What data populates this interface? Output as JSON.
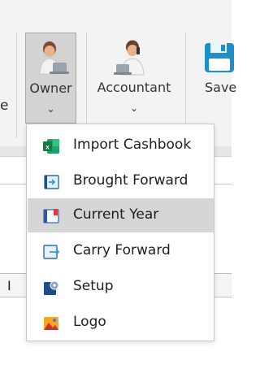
{
  "ribbon": {
    "left_edge_text": "e",
    "owner": {
      "label": "Owner",
      "chevron": "⌄",
      "icon": "person-laptop-icon"
    },
    "accountant": {
      "label": "Accountant",
      "chevron": "⌄",
      "icon": "person-phone-icon"
    },
    "save": {
      "label": "Save",
      "icon": "floppy-disk-icon"
    }
  },
  "content": {
    "cursor_text": "I"
  },
  "menu": {
    "items": [
      {
        "label": "Import Cashbook",
        "icon": "excel-icon",
        "highlighted": false
      },
      {
        "label": "Brought Forward",
        "icon": "book-arrow-in-icon",
        "highlighted": false
      },
      {
        "label": "Current Year",
        "icon": "open-book-icon",
        "highlighted": true
      },
      {
        "label": "Carry Forward",
        "icon": "book-arrow-out-icon",
        "highlighted": false
      },
      {
        "label": "Setup",
        "icon": "gear-book-icon",
        "highlighted": false
      },
      {
        "label": "Logo",
        "icon": "picture-icon",
        "highlighted": false
      }
    ]
  },
  "colors": {
    "highlight": "#d6d6d6",
    "excel_green": "#1d6f42",
    "save_blue": "#1e90c8"
  }
}
